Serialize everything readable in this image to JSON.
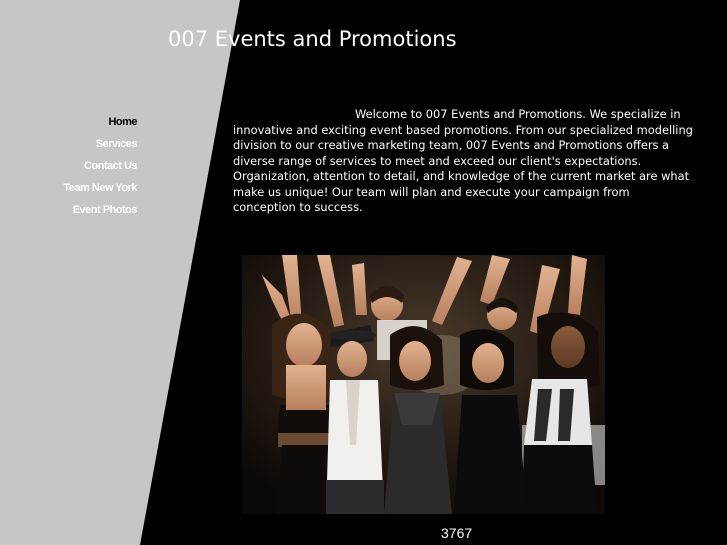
{
  "site": {
    "title": "007 Events and Promotions"
  },
  "nav": {
    "items": [
      {
        "label": "Home",
        "active": true
      },
      {
        "label": "Services",
        "active": false
      },
      {
        "label": "Contact Us",
        "active": false
      },
      {
        "label": "Team New York",
        "active": false
      },
      {
        "label": "Event Photos",
        "active": false
      }
    ]
  },
  "content": {
    "intro": "Welcome to 007 Events and Promotions. We specialize in innovative and exciting event based promotions. From our specialized modelling division to our creative marketing team, 007 Events and Promotions offers a diverse range of services to meet and exceed our client's expectations. Organization, attention to detail, and knowledge of the current market are what make us unique! Our  team will plan and execute your campaign from conception to success."
  },
  "footer": {
    "counter": "3767"
  },
  "colors": {
    "background": "#000000",
    "sidebar_panel": "#c6c6c6",
    "text": "#ffffff"
  }
}
